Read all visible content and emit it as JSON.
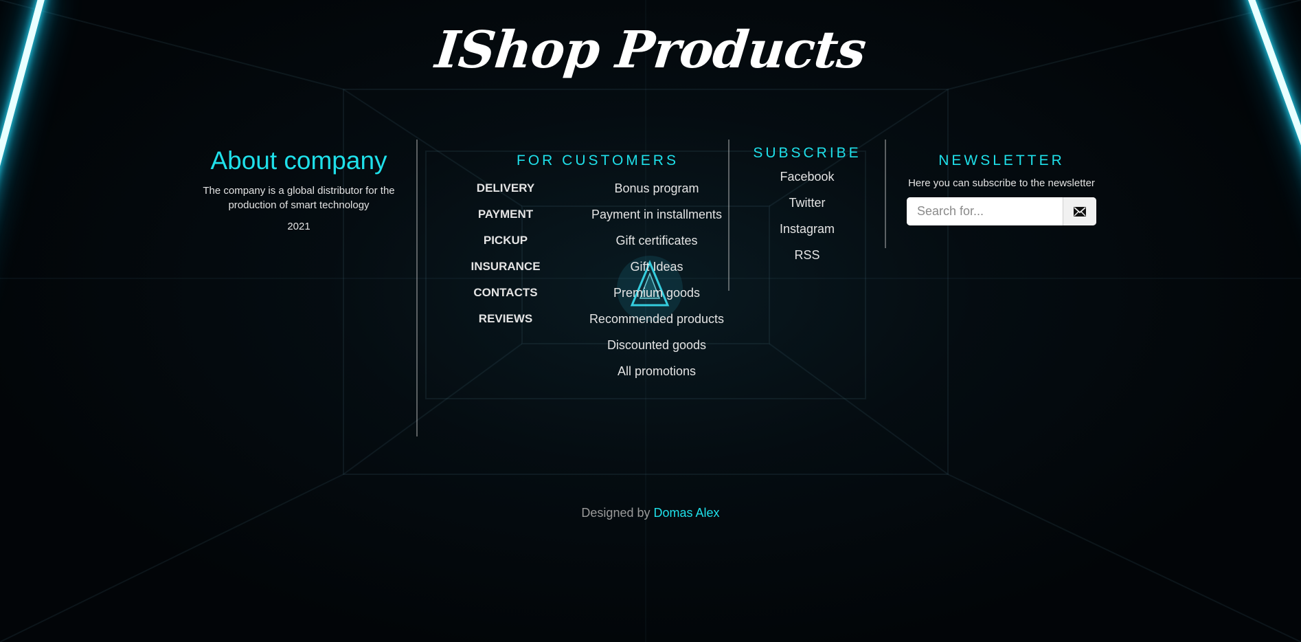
{
  "logo": {
    "text": "IShop Products"
  },
  "about": {
    "title": "About company",
    "description": "The company is a global distributor for the production of smart technology",
    "year": "2021"
  },
  "customers": {
    "title": "FOR CUSTOMERS",
    "main_links": [
      "DELIVERY",
      "PAYMENT",
      "PICKUP",
      "INSURANCE",
      "CONTACTS",
      "REVIEWS"
    ],
    "extra_links": [
      "Bonus program",
      "Payment in installments",
      "Gift certificates",
      "Gift Ideas",
      "Premium goods",
      "Recommended products",
      "Discounted goods",
      "All promotions"
    ]
  },
  "subscribe": {
    "title": "SUBSCRIBE",
    "links": [
      "Facebook",
      "Twitter",
      "Instagram",
      "RSS"
    ]
  },
  "newsletter": {
    "title": "NEWSLETTER",
    "description": "Here you can subscribe to the newsletter",
    "input_placeholder": "Search for...",
    "input_value": "",
    "button_icon": "envelope-icon"
  },
  "footer": {
    "prefix": "Designed by",
    "author": "Domas Alex"
  },
  "colors": {
    "accent": "#1fe0ea",
    "background": "#04080b",
    "text": "#e4e4e4",
    "neon": "#2ee6ff"
  }
}
